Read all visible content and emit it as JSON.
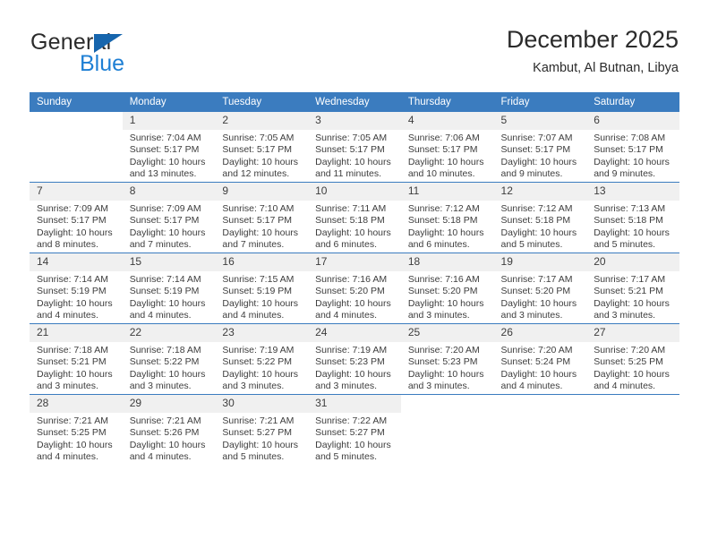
{
  "brand": {
    "name_part1": "General",
    "name_part2": "Blue",
    "accent_color": "#1e7fd4",
    "triangle_color": "#1665ad"
  },
  "header": {
    "title": "December 2025",
    "subtitle": "Kambut, Al Butnan, Libya"
  },
  "calendar": {
    "header_bg": "#3b7cbf",
    "daynum_bg": "#f0f0f0",
    "weekday_headers": [
      "Sunday",
      "Monday",
      "Tuesday",
      "Wednesday",
      "Thursday",
      "Friday",
      "Saturday"
    ],
    "weeks": [
      [
        {
          "day": "",
          "sunrise": "",
          "sunset": "",
          "daylight1": "",
          "daylight2": "",
          "blank": true
        },
        {
          "day": "1",
          "sunrise": "Sunrise: 7:04 AM",
          "sunset": "Sunset: 5:17 PM",
          "daylight1": "Daylight: 10 hours",
          "daylight2": "and 13 minutes."
        },
        {
          "day": "2",
          "sunrise": "Sunrise: 7:05 AM",
          "sunset": "Sunset: 5:17 PM",
          "daylight1": "Daylight: 10 hours",
          "daylight2": "and 12 minutes."
        },
        {
          "day": "3",
          "sunrise": "Sunrise: 7:05 AM",
          "sunset": "Sunset: 5:17 PM",
          "daylight1": "Daylight: 10 hours",
          "daylight2": "and 11 minutes."
        },
        {
          "day": "4",
          "sunrise": "Sunrise: 7:06 AM",
          "sunset": "Sunset: 5:17 PM",
          "daylight1": "Daylight: 10 hours",
          "daylight2": "and 10 minutes."
        },
        {
          "day": "5",
          "sunrise": "Sunrise: 7:07 AM",
          "sunset": "Sunset: 5:17 PM",
          "daylight1": "Daylight: 10 hours",
          "daylight2": "and 9 minutes."
        },
        {
          "day": "6",
          "sunrise": "Sunrise: 7:08 AM",
          "sunset": "Sunset: 5:17 PM",
          "daylight1": "Daylight: 10 hours",
          "daylight2": "and 9 minutes."
        }
      ],
      [
        {
          "day": "7",
          "sunrise": "Sunrise: 7:09 AM",
          "sunset": "Sunset: 5:17 PM",
          "daylight1": "Daylight: 10 hours",
          "daylight2": "and 8 minutes."
        },
        {
          "day": "8",
          "sunrise": "Sunrise: 7:09 AM",
          "sunset": "Sunset: 5:17 PM",
          "daylight1": "Daylight: 10 hours",
          "daylight2": "and 7 minutes."
        },
        {
          "day": "9",
          "sunrise": "Sunrise: 7:10 AM",
          "sunset": "Sunset: 5:17 PM",
          "daylight1": "Daylight: 10 hours",
          "daylight2": "and 7 minutes."
        },
        {
          "day": "10",
          "sunrise": "Sunrise: 7:11 AM",
          "sunset": "Sunset: 5:18 PM",
          "daylight1": "Daylight: 10 hours",
          "daylight2": "and 6 minutes."
        },
        {
          "day": "11",
          "sunrise": "Sunrise: 7:12 AM",
          "sunset": "Sunset: 5:18 PM",
          "daylight1": "Daylight: 10 hours",
          "daylight2": "and 6 minutes."
        },
        {
          "day": "12",
          "sunrise": "Sunrise: 7:12 AM",
          "sunset": "Sunset: 5:18 PM",
          "daylight1": "Daylight: 10 hours",
          "daylight2": "and 5 minutes."
        },
        {
          "day": "13",
          "sunrise": "Sunrise: 7:13 AM",
          "sunset": "Sunset: 5:18 PM",
          "daylight1": "Daylight: 10 hours",
          "daylight2": "and 5 minutes."
        }
      ],
      [
        {
          "day": "14",
          "sunrise": "Sunrise: 7:14 AM",
          "sunset": "Sunset: 5:19 PM",
          "daylight1": "Daylight: 10 hours",
          "daylight2": "and 4 minutes."
        },
        {
          "day": "15",
          "sunrise": "Sunrise: 7:14 AM",
          "sunset": "Sunset: 5:19 PM",
          "daylight1": "Daylight: 10 hours",
          "daylight2": "and 4 minutes."
        },
        {
          "day": "16",
          "sunrise": "Sunrise: 7:15 AM",
          "sunset": "Sunset: 5:19 PM",
          "daylight1": "Daylight: 10 hours",
          "daylight2": "and 4 minutes."
        },
        {
          "day": "17",
          "sunrise": "Sunrise: 7:16 AM",
          "sunset": "Sunset: 5:20 PM",
          "daylight1": "Daylight: 10 hours",
          "daylight2": "and 4 minutes."
        },
        {
          "day": "18",
          "sunrise": "Sunrise: 7:16 AM",
          "sunset": "Sunset: 5:20 PM",
          "daylight1": "Daylight: 10 hours",
          "daylight2": "and 3 minutes."
        },
        {
          "day": "19",
          "sunrise": "Sunrise: 7:17 AM",
          "sunset": "Sunset: 5:20 PM",
          "daylight1": "Daylight: 10 hours",
          "daylight2": "and 3 minutes."
        },
        {
          "day": "20",
          "sunrise": "Sunrise: 7:17 AM",
          "sunset": "Sunset: 5:21 PM",
          "daylight1": "Daylight: 10 hours",
          "daylight2": "and 3 minutes."
        }
      ],
      [
        {
          "day": "21",
          "sunrise": "Sunrise: 7:18 AM",
          "sunset": "Sunset: 5:21 PM",
          "daylight1": "Daylight: 10 hours",
          "daylight2": "and 3 minutes."
        },
        {
          "day": "22",
          "sunrise": "Sunrise: 7:18 AM",
          "sunset": "Sunset: 5:22 PM",
          "daylight1": "Daylight: 10 hours",
          "daylight2": "and 3 minutes."
        },
        {
          "day": "23",
          "sunrise": "Sunrise: 7:19 AM",
          "sunset": "Sunset: 5:22 PM",
          "daylight1": "Daylight: 10 hours",
          "daylight2": "and 3 minutes."
        },
        {
          "day": "24",
          "sunrise": "Sunrise: 7:19 AM",
          "sunset": "Sunset: 5:23 PM",
          "daylight1": "Daylight: 10 hours",
          "daylight2": "and 3 minutes."
        },
        {
          "day": "25",
          "sunrise": "Sunrise: 7:20 AM",
          "sunset": "Sunset: 5:23 PM",
          "daylight1": "Daylight: 10 hours",
          "daylight2": "and 3 minutes."
        },
        {
          "day": "26",
          "sunrise": "Sunrise: 7:20 AM",
          "sunset": "Sunset: 5:24 PM",
          "daylight1": "Daylight: 10 hours",
          "daylight2": "and 4 minutes."
        },
        {
          "day": "27",
          "sunrise": "Sunrise: 7:20 AM",
          "sunset": "Sunset: 5:25 PM",
          "daylight1": "Daylight: 10 hours",
          "daylight2": "and 4 minutes."
        }
      ],
      [
        {
          "day": "28",
          "sunrise": "Sunrise: 7:21 AM",
          "sunset": "Sunset: 5:25 PM",
          "daylight1": "Daylight: 10 hours",
          "daylight2": "and 4 minutes."
        },
        {
          "day": "29",
          "sunrise": "Sunrise: 7:21 AM",
          "sunset": "Sunset: 5:26 PM",
          "daylight1": "Daylight: 10 hours",
          "daylight2": "and 4 minutes."
        },
        {
          "day": "30",
          "sunrise": "Sunrise: 7:21 AM",
          "sunset": "Sunset: 5:27 PM",
          "daylight1": "Daylight: 10 hours",
          "daylight2": "and 5 minutes."
        },
        {
          "day": "31",
          "sunrise": "Sunrise: 7:22 AM",
          "sunset": "Sunset: 5:27 PM",
          "daylight1": "Daylight: 10 hours",
          "daylight2": "and 5 minutes."
        },
        {
          "day": "",
          "sunrise": "",
          "sunset": "",
          "daylight1": "",
          "daylight2": "",
          "blank": true
        },
        {
          "day": "",
          "sunrise": "",
          "sunset": "",
          "daylight1": "",
          "daylight2": "",
          "blank": true
        },
        {
          "day": "",
          "sunrise": "",
          "sunset": "",
          "daylight1": "",
          "daylight2": "",
          "blank": true
        }
      ]
    ]
  }
}
